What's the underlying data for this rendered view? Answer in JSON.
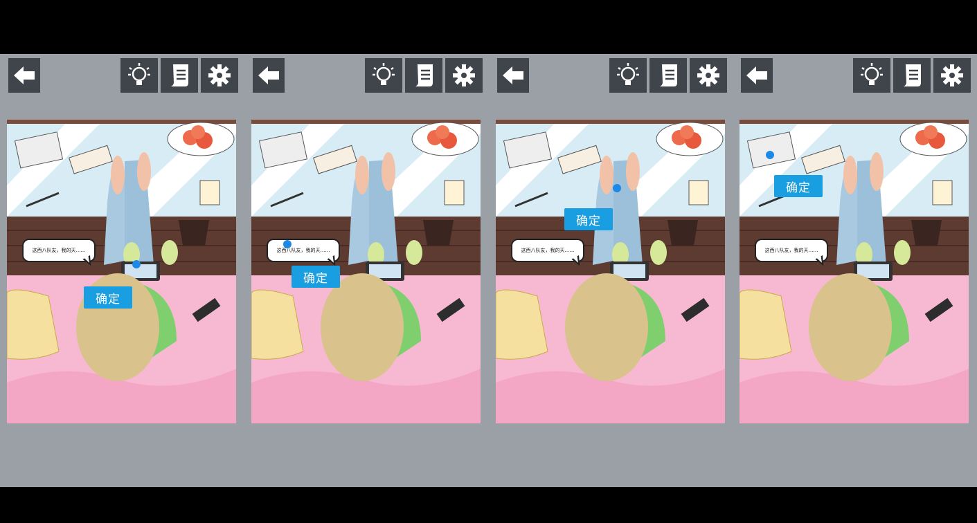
{
  "panels": [
    {
      "id": "1",
      "speech": "这西八队友，我的天……",
      "confirm_label": "确定"
    },
    {
      "id": "2",
      "speech": "这西八队友，我的天……",
      "confirm_label": "确定"
    },
    {
      "id": "3",
      "speech": "这西八队友，我的天……",
      "confirm_label": "确定"
    },
    {
      "id": "4",
      "speech": "这西八队友，我的天……",
      "confirm_label": "确定"
    }
  ],
  "toolbar": {
    "icons": [
      "back-arrow-icon",
      "lightbulb-hint-icon",
      "scroll-notes-icon",
      "gear-icon"
    ]
  },
  "colors": {
    "background": "#9aa0a6",
    "toolbar_button": "#40454b",
    "confirm_button": "#1a9ee2",
    "tap_dot": "#1e88e5"
  }
}
